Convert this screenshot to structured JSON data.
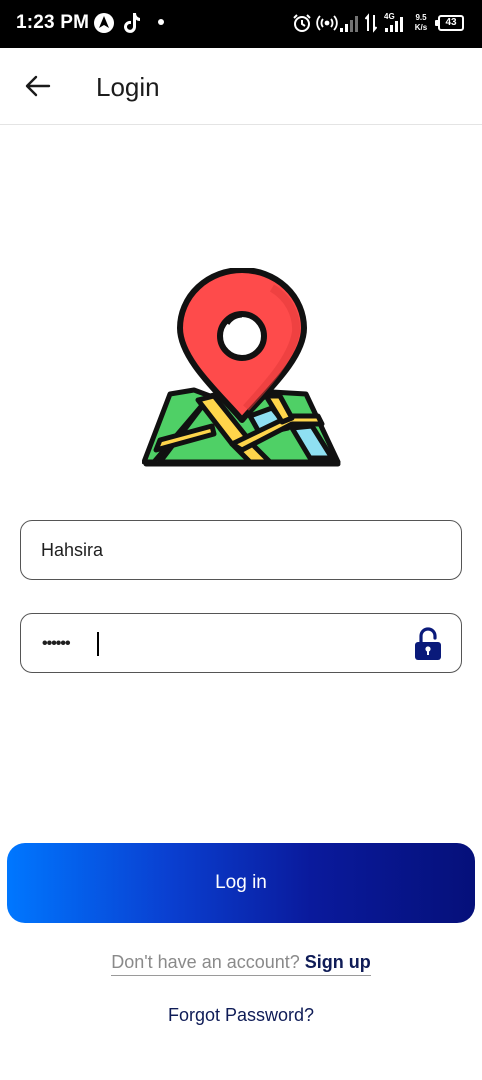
{
  "status_bar": {
    "time": "1:23 PM",
    "icons": [
      "navigation-app-icon",
      "tiktok-icon",
      "notification-dot",
      "alarm-icon",
      "hotspot-icon",
      "signal-bars-icon",
      "data-arrows-icon",
      "signal-4g-icon",
      "network-speed-icon",
      "battery-icon"
    ],
    "network_type": "4G",
    "speed_value": "9.5",
    "speed_unit": "K/s",
    "battery_level": "43"
  },
  "app_bar": {
    "back_icon": "arrow-left-icon",
    "title": "Login"
  },
  "logo": {
    "icon": "map-location-pin-icon",
    "colors": {
      "pin": "#fe4b4b",
      "map_green": "#4fd066",
      "map_yellow": "#ffd54b",
      "map_blue": "#8fe0f2",
      "outline": "#111111"
    }
  },
  "form": {
    "username_value": "Hahsira",
    "password_mask": "••••••",
    "lock_icon": "unlock-icon",
    "lock_color": "#0a1a7a"
  },
  "login_button": {
    "label": "Log in",
    "gradient_start": "#0077ff",
    "gradient_end": "#05107a"
  },
  "signup": {
    "prompt": "Don't have an account?",
    "link": "Sign up"
  },
  "forgot_password": "Forgot Password?"
}
